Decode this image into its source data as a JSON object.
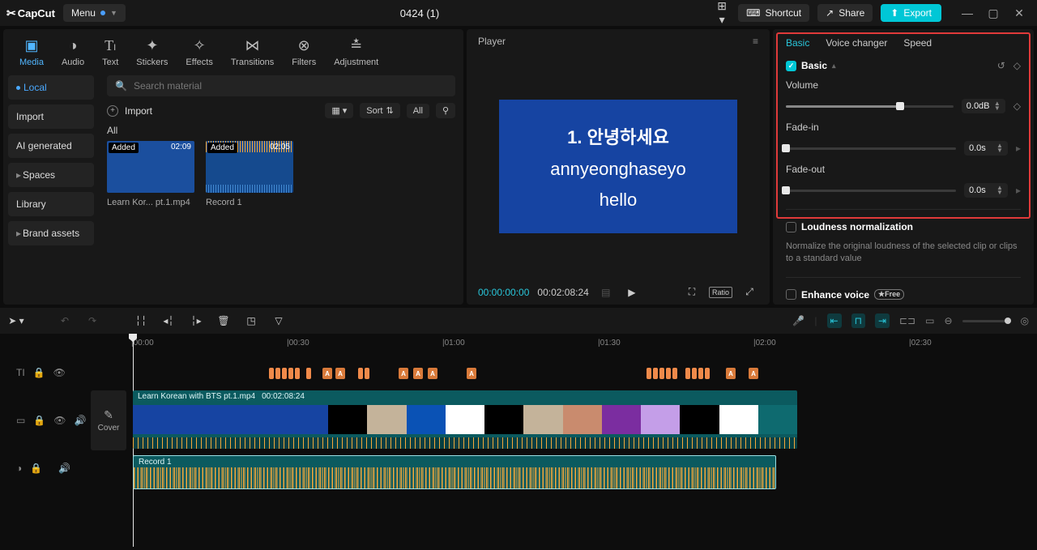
{
  "titlebar": {
    "logo": "CapCut",
    "menu": "Menu",
    "project": "0424 (1)",
    "shortcut": "Shortcut",
    "share": "Share",
    "export": "Export"
  },
  "media_tabs": {
    "media": "Media",
    "audio": "Audio",
    "text": "Text",
    "stickers": "Stickers",
    "effects": "Effects",
    "transitions": "Transitions",
    "filters": "Filters",
    "adjustment": "Adjustment"
  },
  "sidebar": {
    "local": "Local",
    "import": "Import",
    "ai": "AI generated",
    "spaces": "Spaces",
    "library": "Library",
    "brand": "Brand assets"
  },
  "media": {
    "search_placeholder": "Search material",
    "import": "Import",
    "view_sort": "Sort",
    "view_all": "All",
    "all": "All",
    "clip1": {
      "badge": "Added",
      "dur": "02:09",
      "name": "Learn Kor... pt.1.mp4"
    },
    "clip2": {
      "badge": "Added",
      "dur": "02:05",
      "name": "Record 1"
    }
  },
  "player": {
    "title": "Player",
    "line1": "1. 안녕하세요",
    "line2": "annyeonghaseyo",
    "line3": "hello",
    "tc_current": "00:00:00:00",
    "tc_total": "00:02:08:24",
    "ratio": "Ratio"
  },
  "props": {
    "tab_basic": "Basic",
    "tab_voice": "Voice changer",
    "tab_speed": "Speed",
    "section": "Basic",
    "volume": "Volume",
    "volume_val": "0.0dB",
    "fadein": "Fade-in",
    "fadein_val": "0.0s",
    "fadeout": "Fade-out",
    "fadeout_val": "0.0s",
    "loudness": "Loudness normalization",
    "loudness_desc": "Normalize the original loudness of the selected clip or clips to a standard value",
    "enhance": "Enhance voice",
    "free": "Free"
  },
  "timeline": {
    "ruler": [
      "00:00",
      "00:30",
      "01:00",
      "01:30",
      "02:00",
      "02:30"
    ],
    "cover": "Cover",
    "video_name": "Learn Korean with BTS pt.1.mp4",
    "video_dur": "00:02:08:24",
    "audio_name": "Record 1"
  }
}
